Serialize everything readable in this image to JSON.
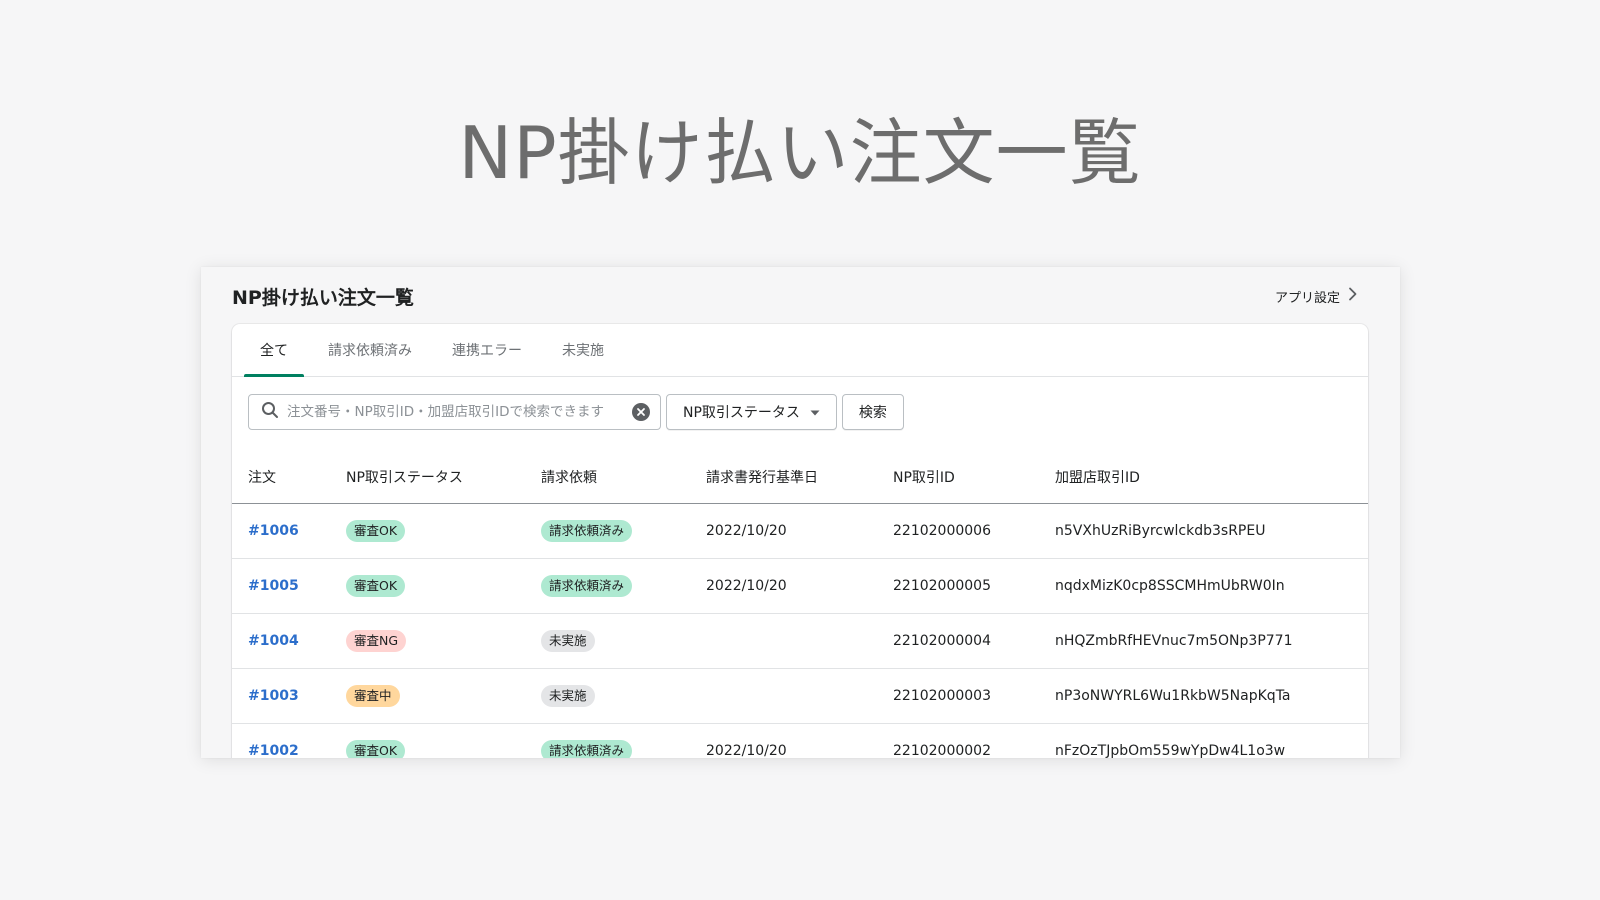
{
  "hero": {
    "title": "NP掛け払い注文一覧"
  },
  "header": {
    "title": "NP掛け払い注文一覧",
    "settings_link": "アプリ設定"
  },
  "tabs": [
    {
      "label": "全て",
      "active": true
    },
    {
      "label": "請求依頼済み",
      "active": false
    },
    {
      "label": "連携エラー",
      "active": false
    },
    {
      "label": "未実施",
      "active": false
    }
  ],
  "filters": {
    "search_placeholder": "注文番号・NP取引ID・加盟店取引IDで検索できます",
    "search_value": "",
    "status_dropdown": "NP取引ステータス",
    "search_button": "検索"
  },
  "table": {
    "columns": [
      "注文",
      "NP取引ステータス",
      "請求依頼",
      "請求書発行基準日",
      "NP取引ID",
      "加盟店取引ID"
    ],
    "rows": [
      {
        "order": "#1006",
        "status": "審査OK",
        "status_kind": "ok",
        "request": "請求依頼済み",
        "request_kind": "ok",
        "date": "2022/10/20",
        "np_id": "22102000006",
        "merchant_id": "n5VXhUzRiByrcwlckdb3sRPEU"
      },
      {
        "order": "#1005",
        "status": "審査OK",
        "status_kind": "ok",
        "request": "請求依頼済み",
        "request_kind": "ok",
        "date": "2022/10/20",
        "np_id": "22102000005",
        "merchant_id": "nqdxMizK0cp8SSCMHmUbRW0In"
      },
      {
        "order": "#1004",
        "status": "審査NG",
        "status_kind": "ng",
        "request": "未実施",
        "request_kind": "none",
        "date": "",
        "np_id": "22102000004",
        "merchant_id": "nHQZmbRfHEVnuc7m5ONp3P771"
      },
      {
        "order": "#1003",
        "status": "審査中",
        "status_kind": "pending",
        "request": "未実施",
        "request_kind": "none",
        "date": "",
        "np_id": "22102000003",
        "merchant_id": "nP3oNWYRL6Wu1RkbW5NapKqTa"
      },
      {
        "order": "#1002",
        "status": "審査OK",
        "status_kind": "ok",
        "request": "請求依頼済み",
        "request_kind": "ok",
        "date": "2022/10/20",
        "np_id": "22102000002",
        "merchant_id": "nFzOzTJpbOm559wYpDw4L1o3w"
      }
    ]
  },
  "colors": {
    "accent": "#008060",
    "link": "#2c6ecb",
    "badge_ok": "#aee9d1",
    "badge_ng": "#fed3d1",
    "badge_pending": "#ffd79d",
    "badge_none": "#e4e5e7"
  },
  "icons": {
    "search": "search-icon",
    "clear": "clear-icon",
    "dropdown": "caret-down-icon",
    "settings_link": "chevron-right-icon"
  }
}
